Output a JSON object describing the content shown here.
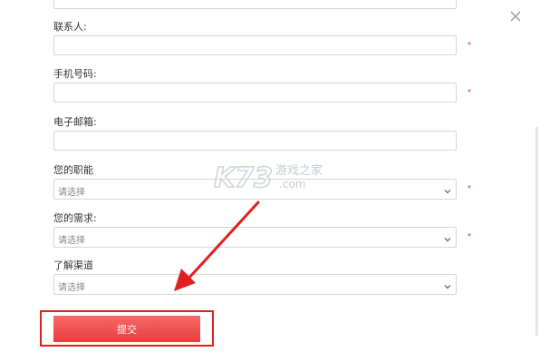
{
  "form": {
    "contact_label": "联系人:",
    "phone_label": "手机号码:",
    "email_label": "电子邮箱:",
    "position_label": "您的职能",
    "needs_label": "您的需求:",
    "channel_label": "了解渠道",
    "required_mark": "*",
    "select_placeholder": "请选择",
    "submit_label": "提交"
  },
  "watermark": {
    "logo": "K73",
    "site_cn": "游戏之家",
    "site_tld": ".com"
  },
  "colors": {
    "required": "#e33333",
    "submit_button": "#ef4a4a",
    "highlight_frame": "#e02020",
    "arrow": "#e02020"
  },
  "icons": {
    "close": "close-icon",
    "select": "chevron-down-icon"
  }
}
